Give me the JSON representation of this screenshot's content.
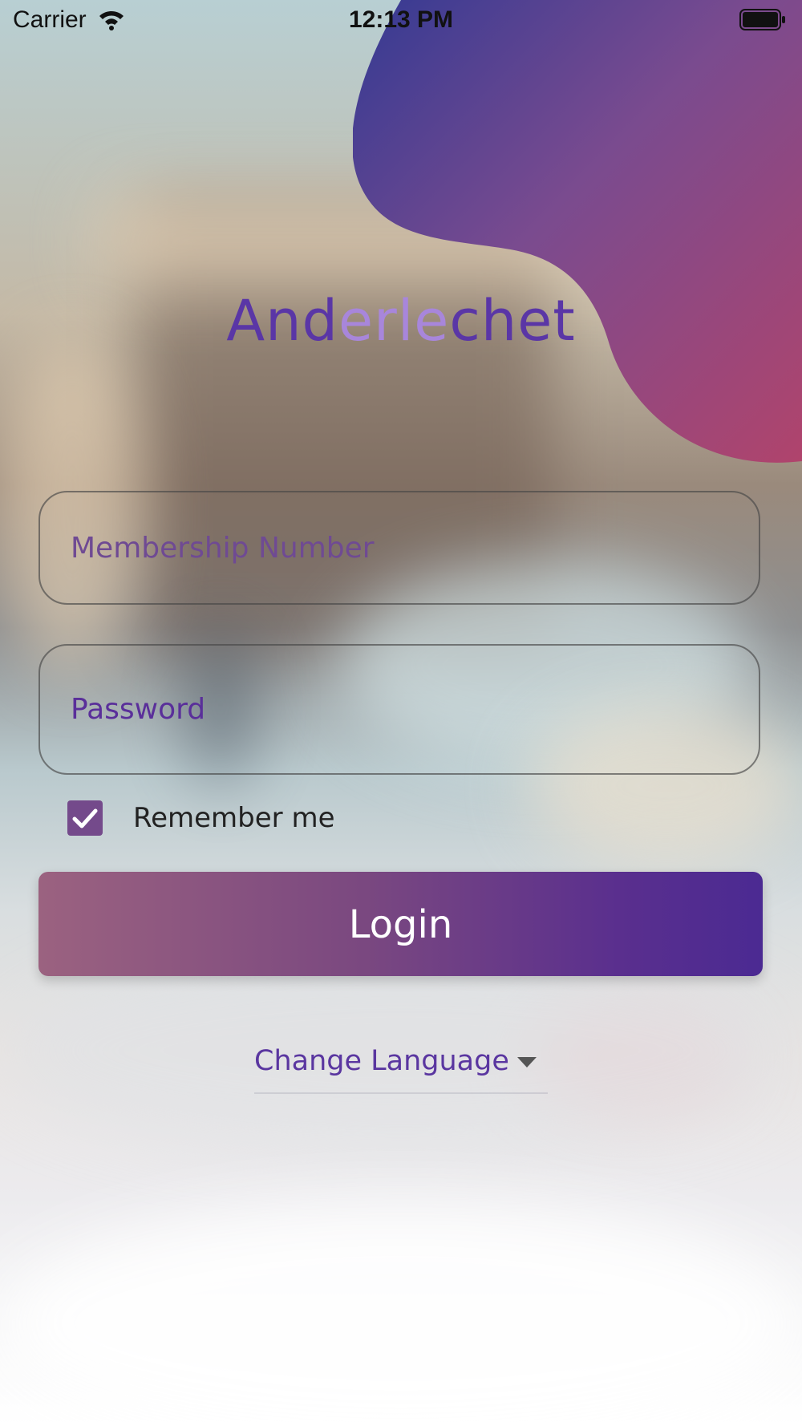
{
  "status_bar": {
    "carrier": "Carrier",
    "time": "12:13 PM",
    "wifi_icon": "wifi-icon",
    "battery_icon": "battery-full-icon"
  },
  "brand": {
    "title_dark_start": "And",
    "title_light": "erle",
    "title_dark_end": "chet",
    "title_color": "#5a36a6",
    "title_highlight_color": "#a886db"
  },
  "form": {
    "membership_placeholder": "Membership Number",
    "membership_value": "",
    "password_placeholder": "Password",
    "password_value": "",
    "remember_me_label": "Remember me",
    "remember_me_checked": true,
    "login_label": "Login",
    "accent_color": "#744a8b"
  },
  "language": {
    "label": "Change Language",
    "caret_icon": "caret-down-icon"
  },
  "colors": {
    "gradient_start": "#9b6280",
    "gradient_end": "#4b2a92",
    "corner_shape_start": "#3a3a94",
    "corner_shape_end": "#b0466e"
  }
}
